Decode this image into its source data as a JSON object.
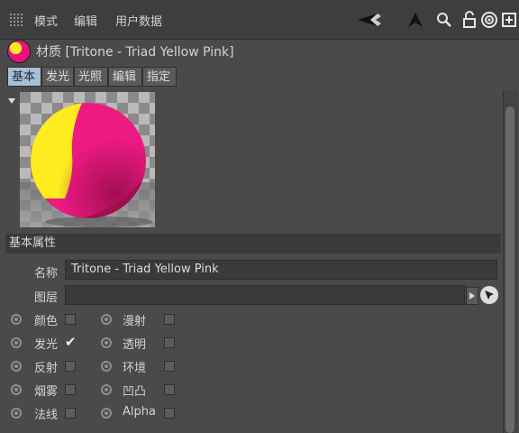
{
  "menubar": {
    "items": [
      "模式",
      "编辑",
      "用户数据"
    ],
    "icons": [
      "back-arrow-icon",
      "up-arrow-icon",
      "search-icon",
      "lock-icon",
      "target-icon",
      "new-window-icon"
    ]
  },
  "material": {
    "title": "材质 [Tritone - Triad Yellow Pink]",
    "colors": {
      "yellow": "#ffe72a",
      "pink": "#e8137d"
    }
  },
  "tabs": [
    {
      "label": "基本",
      "active": true
    },
    {
      "label": "发光",
      "active": false
    },
    {
      "label": "光照",
      "active": false
    },
    {
      "label": "编辑",
      "active": false
    },
    {
      "label": "指定",
      "active": false
    }
  ],
  "section": {
    "title": "基本属性"
  },
  "fields": {
    "name_label": "名称",
    "name_value": "Tritone - Triad Yellow Pink",
    "layer_label": "图层",
    "layer_value": ""
  },
  "channels": {
    "left": [
      {
        "label": "颜色",
        "checked": false
      },
      {
        "label": "发光",
        "checked": true
      },
      {
        "label": "反射",
        "checked": false
      },
      {
        "label": "烟雾",
        "checked": false
      },
      {
        "label": "法线",
        "checked": false
      }
    ],
    "right": [
      {
        "label": "漫射",
        "checked": false
      },
      {
        "label": "透明",
        "checked": false
      },
      {
        "label": "环境",
        "checked": false
      },
      {
        "label": "凹凸",
        "checked": false
      },
      {
        "label": "Alpha",
        "checked": false
      }
    ]
  }
}
